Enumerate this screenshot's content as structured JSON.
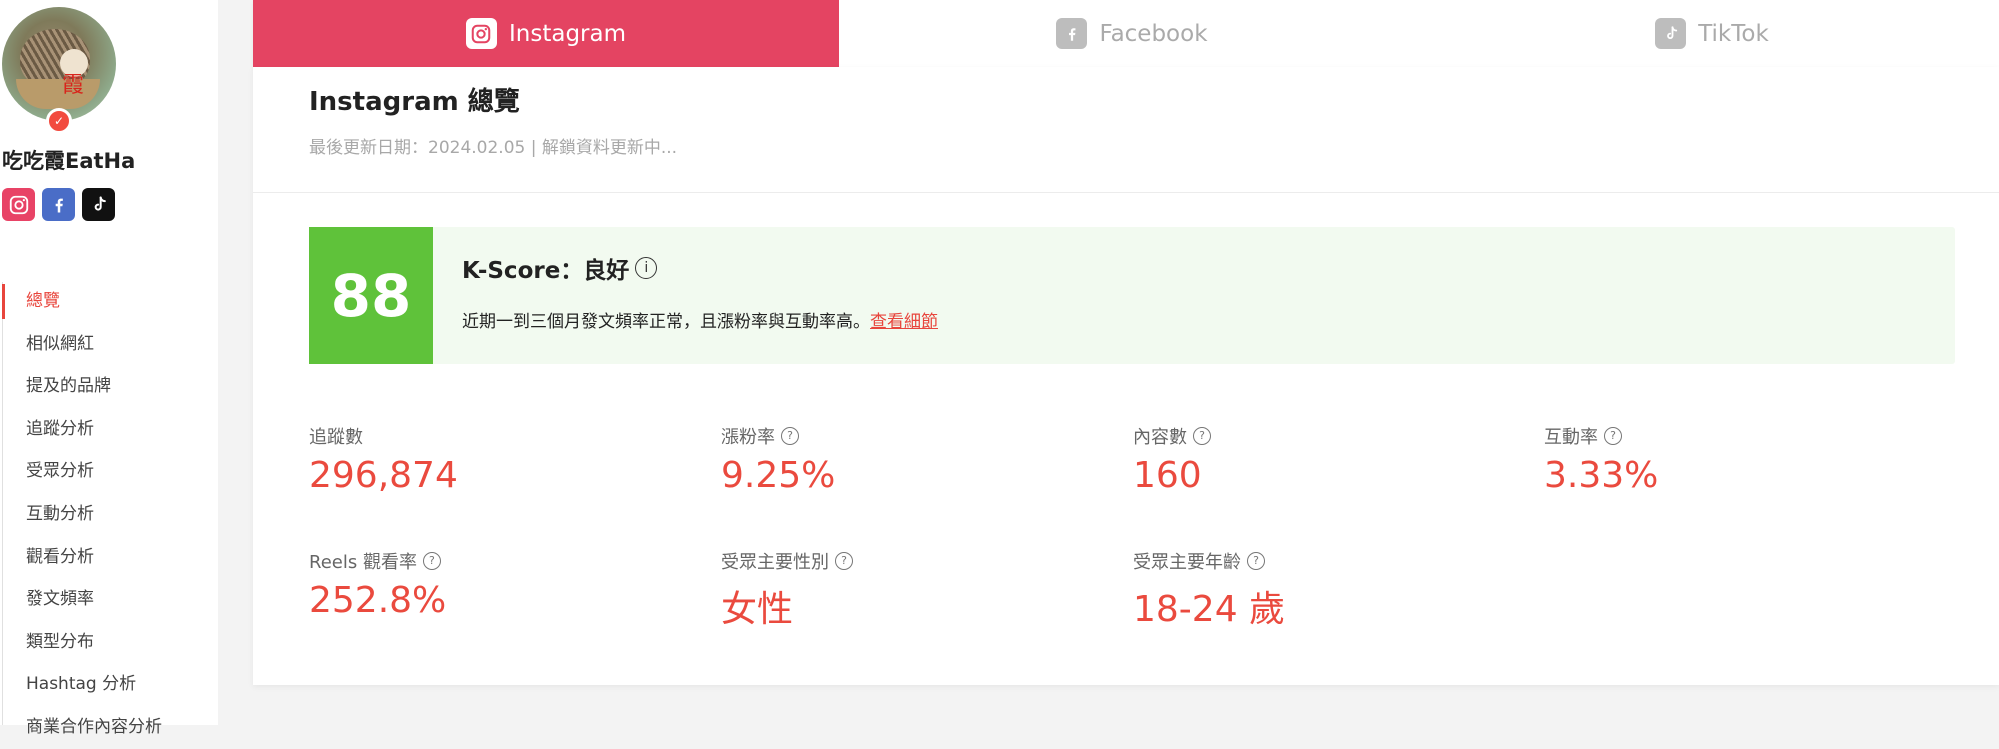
{
  "profile": {
    "name": "吃吃霞EatHa",
    "avatar_seal": "霞",
    "social": [
      "instagram-icon",
      "facebook-icon",
      "tiktok-icon"
    ]
  },
  "sidebar": {
    "items": [
      {
        "label": "總覽",
        "active": true
      },
      {
        "label": "相似網紅"
      },
      {
        "label": "提及的品牌"
      },
      {
        "label": "追蹤分析"
      },
      {
        "label": "受眾分析"
      },
      {
        "label": "互動分析"
      },
      {
        "label": "觀看分析"
      },
      {
        "label": "發文頻率"
      },
      {
        "label": "類型分布"
      },
      {
        "label": "Hashtag 分析"
      },
      {
        "label": "商業合作內容分析"
      }
    ]
  },
  "tabs": [
    {
      "label": "Instagram",
      "icon": "instagram-icon",
      "active": true
    },
    {
      "label": "Facebook",
      "icon": "facebook-icon"
    },
    {
      "label": "TikTok",
      "icon": "tiktok-icon"
    }
  ],
  "overview": {
    "title": "Instagram 總覽",
    "subtitle": "最後更新日期：2024.02.05 | 解鎖資料更新中..."
  },
  "kscore": {
    "score": "88",
    "title": "K-Score：良好",
    "desc": "近期一到三個月發文頻率正常，且漲粉率與互動率高。",
    "link": "查看細節",
    "color": "#5fc23a"
  },
  "stats": {
    "followers": {
      "label": "追蹤數",
      "value": "296,874"
    },
    "growth": {
      "label": "漲粉率",
      "value": "9.25%"
    },
    "posts": {
      "label": "內容數",
      "value": "160"
    },
    "engagement": {
      "label": "互動率",
      "value": "3.33%"
    },
    "reels": {
      "label": "Reels 觀看率",
      "value": "252.8%"
    },
    "gender": {
      "label": "受眾主要性別",
      "value": "女性"
    },
    "age": {
      "label": "受眾主要年齡",
      "value": "18-24 歲"
    }
  },
  "colors": {
    "accent": "#e44462",
    "value": "#ea4a3e",
    "score_bg": "#f2faf0"
  }
}
